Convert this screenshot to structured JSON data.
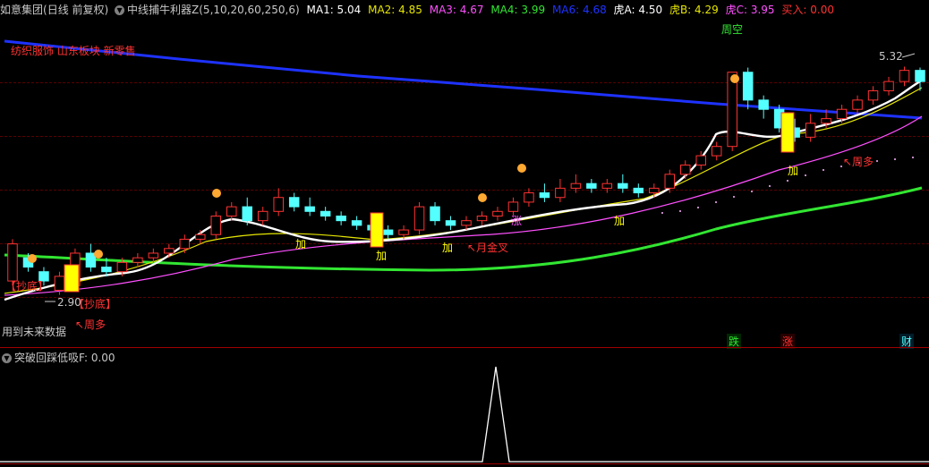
{
  "header": {
    "stock_name": "如意集团",
    "period_label": "(日线 前复权)",
    "indicator_name": "中线捕牛利器Z(5,10,20,60,250,6)",
    "ma1": "MA1: 5.04",
    "ma2": "MA2: 4.85",
    "ma3": "MA3: 4.67",
    "ma4": "MA4: 3.99",
    "ma6": "MA6: 4.68",
    "huA": "虎A: 4.50",
    "huB": "虎B: 4.29",
    "huC": "虎C: 3.95",
    "buy_in": "买入: 0.00"
  },
  "main_chart": {
    "sector_note": "纺织服饰 山东板块 新零售",
    "top_right_price": "5.32",
    "low_price": "2.90",
    "weekly_short": "周空",
    "future_data_note": "用到未来数据",
    "labels": {
      "bottom_fish_1": "【抄底】",
      "bottom_fish_2": "【抄底】",
      "weekly_long_1": "↖周多",
      "weekly_long_2": "↖周多",
      "monthly_golden": "↖月金叉",
      "add_1": "加",
      "add_2": "加",
      "add_3": "加",
      "add_4": "加",
      "add_5": "加",
      "rise": "涨"
    },
    "bottom_tags": {
      "fall": "跌",
      "rise": "涨",
      "finance": "财"
    }
  },
  "sub_chart": {
    "title": "突破回踩低吸F",
    "value": ": 0.00"
  },
  "colors": {
    "up": "#ff3232",
    "down": "#54ffff",
    "ma_white": "#ffffff",
    "ma_yellow": "#e6e600",
    "ma_pink": "#ff50ff",
    "ma_green": "#32e632",
    "ma_blue": "#1e32ff",
    "signal_bar": "#ffff00"
  },
  "chart_data": {
    "type": "candlestick",
    "title": "如意集团 (日线 前复权)",
    "ylim": [
      2.8,
      5.5
    ],
    "candles": [
      [
        3.05,
        3.45,
        3.0,
        3.5
      ],
      [
        3.3,
        3.2,
        3.15,
        3.35
      ],
      [
        3.15,
        3.05,
        3.0,
        3.2
      ],
      [
        2.95,
        3.1,
        2.9,
        3.15
      ],
      [
        3.0,
        3.35,
        2.95,
        3.4
      ],
      [
        3.35,
        3.2,
        3.15,
        3.45
      ],
      [
        3.2,
        3.15,
        3.1,
        3.3
      ],
      [
        3.15,
        3.25,
        3.1,
        3.3
      ],
      [
        3.25,
        3.3,
        3.2,
        3.35
      ],
      [
        3.3,
        3.35,
        3.25,
        3.4
      ],
      [
        3.35,
        3.4,
        3.3,
        3.45
      ],
      [
        3.4,
        3.5,
        3.35,
        3.55
      ],
      [
        3.5,
        3.55,
        3.45,
        3.6
      ],
      [
        3.55,
        3.75,
        3.5,
        3.8
      ],
      [
        3.75,
        3.85,
        3.7,
        3.9
      ],
      [
        3.85,
        3.7,
        3.65,
        3.95
      ],
      [
        3.7,
        3.8,
        3.65,
        3.85
      ],
      [
        3.8,
        3.95,
        3.75,
        4.05
      ],
      [
        3.95,
        3.85,
        3.8,
        4.0
      ],
      [
        3.85,
        3.8,
        3.75,
        3.95
      ],
      [
        3.8,
        3.75,
        3.7,
        3.85
      ],
      [
        3.75,
        3.7,
        3.65,
        3.8
      ],
      [
        3.7,
        3.65,
        3.6,
        3.75
      ],
      [
        3.65,
        3.6,
        3.55,
        3.7
      ],
      [
        3.6,
        3.55,
        3.5,
        3.65
      ],
      [
        3.55,
        3.6,
        3.5,
        3.65
      ],
      [
        3.6,
        3.85,
        3.55,
        3.9
      ],
      [
        3.85,
        3.7,
        3.65,
        3.9
      ],
      [
        3.7,
        3.65,
        3.6,
        3.75
      ],
      [
        3.65,
        3.7,
        3.6,
        3.75
      ],
      [
        3.7,
        3.75,
        3.65,
        3.8
      ],
      [
        3.75,
        3.8,
        3.7,
        3.85
      ],
      [
        3.8,
        3.9,
        3.75,
        3.95
      ],
      [
        3.9,
        4.0,
        3.85,
        4.05
      ],
      [
        4.0,
        3.95,
        3.9,
        4.1
      ],
      [
        3.95,
        4.05,
        3.9,
        4.15
      ],
      [
        4.05,
        4.1,
        4.0,
        4.2
      ],
      [
        4.1,
        4.05,
        4.0,
        4.15
      ],
      [
        4.05,
        4.1,
        4.0,
        4.15
      ],
      [
        4.1,
        4.05,
        4.0,
        4.2
      ],
      [
        4.05,
        4.0,
        3.95,
        4.1
      ],
      [
        4.0,
        4.05,
        3.95,
        4.1
      ],
      [
        4.05,
        4.2,
        4.0,
        4.25
      ],
      [
        4.2,
        4.3,
        4.15,
        4.35
      ],
      [
        4.3,
        4.4,
        4.25,
        4.45
      ],
      [
        4.4,
        4.5,
        4.35,
        4.55
      ],
      [
        4.5,
        5.3,
        4.45,
        5.3
      ],
      [
        5.3,
        5.0,
        4.9,
        5.35
      ],
      [
        5.0,
        4.9,
        4.8,
        5.05
      ],
      [
        4.9,
        4.7,
        4.65,
        4.95
      ],
      [
        4.7,
        4.6,
        4.55,
        4.8
      ],
      [
        4.6,
        4.75,
        4.55,
        4.85
      ],
      [
        4.75,
        4.8,
        4.7,
        4.9
      ],
      [
        4.8,
        4.9,
        4.75,
        4.95
      ],
      [
        4.9,
        5.0,
        4.85,
        5.05
      ],
      [
        5.0,
        5.1,
        4.95,
        5.15
      ],
      [
        5.1,
        5.2,
        5.05,
        5.25
      ],
      [
        5.2,
        5.32,
        5.15,
        5.36
      ],
      [
        5.32,
        5.2,
        5.1,
        5.35
      ]
    ]
  }
}
